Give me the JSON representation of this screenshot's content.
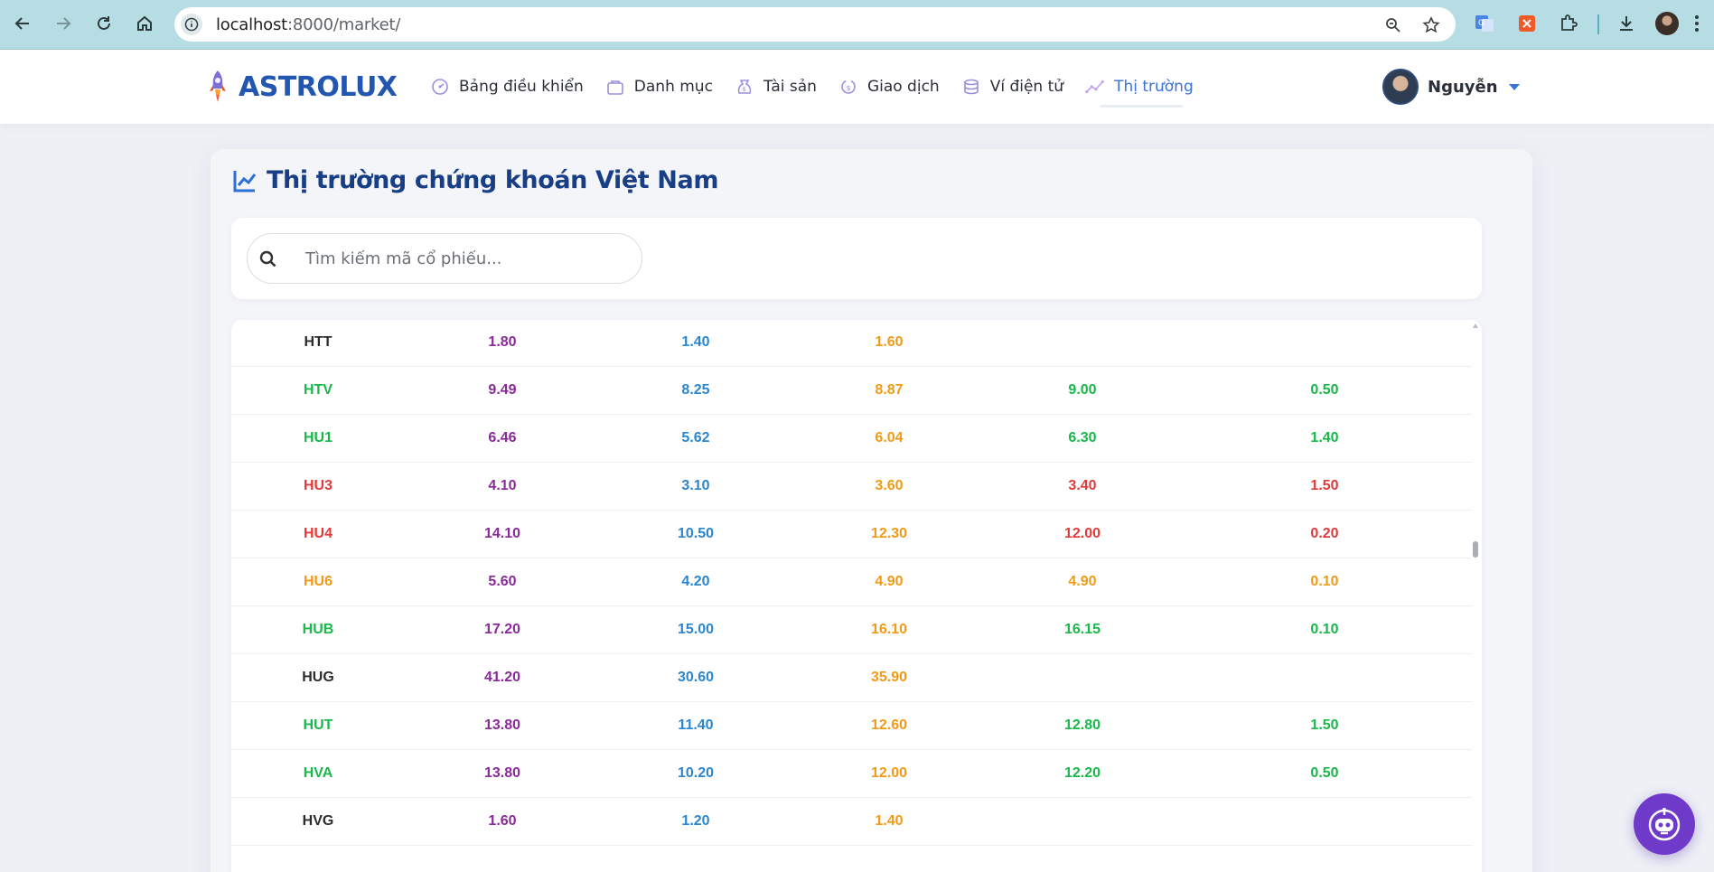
{
  "browser": {
    "url_host": "localhost",
    "url_rest": ":8000/market/"
  },
  "brand": {
    "name": "ASTROLUX"
  },
  "nav": {
    "items": [
      {
        "label": "Bảng điều khiển",
        "icon": "dashboard-icon"
      },
      {
        "label": "Danh mục",
        "icon": "portfolio-icon"
      },
      {
        "label": "Tài sản",
        "icon": "assets-icon"
      },
      {
        "label": "Giao dịch",
        "icon": "transaction-icon"
      },
      {
        "label": "Ví điện tử",
        "icon": "wallet-icon"
      },
      {
        "label": "Thị trường",
        "icon": "market-chart-icon",
        "active": true
      }
    ]
  },
  "user": {
    "name": "Nguyễn"
  },
  "page": {
    "title": "Thị trường chứng khoán Việt Nam"
  },
  "search": {
    "placeholder": "Tìm kiếm mã cổ phiếu..."
  },
  "colors": {
    "brand": "#2256b0",
    "ceiling": "#8a2a9a",
    "floor": "#2a86d0",
    "reference": "#f29a16",
    "up": "#18b84a",
    "down": "#e03a3a"
  },
  "stocks": [
    {
      "code": "HTT",
      "ceil": "1.80",
      "floor": "1.40",
      "ref": "1.60",
      "match": "",
      "change": "",
      "status": "none"
    },
    {
      "code": "HTV",
      "ceil": "9.49",
      "floor": "8.25",
      "ref": "8.87",
      "match": "9.00",
      "change": "0.50",
      "status": "up"
    },
    {
      "code": "HU1",
      "ceil": "6.46",
      "floor": "5.62",
      "ref": "6.04",
      "match": "6.30",
      "change": "1.40",
      "status": "up"
    },
    {
      "code": "HU3",
      "ceil": "4.10",
      "floor": "3.10",
      "ref": "3.60",
      "match": "3.40",
      "change": "1.50",
      "status": "down"
    },
    {
      "code": "HU4",
      "ceil": "14.10",
      "floor": "10.50",
      "ref": "12.30",
      "match": "12.00",
      "change": "0.20",
      "status": "down"
    },
    {
      "code": "HU6",
      "ceil": "5.60",
      "floor": "4.20",
      "ref": "4.90",
      "match": "4.90",
      "change": "0.10",
      "status": "ref"
    },
    {
      "code": "HUB",
      "ceil": "17.20",
      "floor": "15.00",
      "ref": "16.10",
      "match": "16.15",
      "change": "0.10",
      "status": "up"
    },
    {
      "code": "HUG",
      "ceil": "41.20",
      "floor": "30.60",
      "ref": "35.90",
      "match": "",
      "change": "",
      "status": "none"
    },
    {
      "code": "HUT",
      "ceil": "13.80",
      "floor": "11.40",
      "ref": "12.60",
      "match": "12.80",
      "change": "1.50",
      "status": "up"
    },
    {
      "code": "HVA",
      "ceil": "13.80",
      "floor": "10.20",
      "ref": "12.00",
      "match": "12.20",
      "change": "0.50",
      "status": "up"
    },
    {
      "code": "HVG",
      "ceil": "1.60",
      "floor": "1.20",
      "ref": "1.40",
      "match": "",
      "change": "",
      "status": "none"
    }
  ]
}
